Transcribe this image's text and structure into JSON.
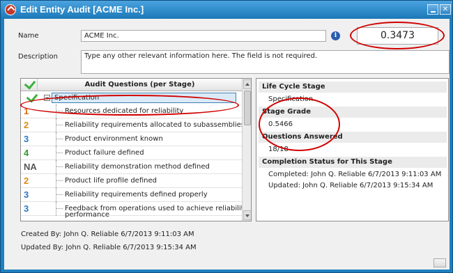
{
  "window": {
    "title": "Edit Entity Audit [ACME Inc.]",
    "close_glyph": "✕"
  },
  "form": {
    "name_label": "Name",
    "name_value": "ACME Inc.",
    "description_label": "Description",
    "description_value": "Type any other relevant information here. The field is not required.",
    "score": "0.3473",
    "info_glyph": "i"
  },
  "questions": {
    "header": "Audit Questions (per Stage)",
    "stage": "Specification",
    "rows": [
      {
        "grade": "1",
        "color": "#e06a10",
        "text": "Resources dedicated for reliability"
      },
      {
        "grade": "2",
        "color": "#e08a10",
        "text": "Reliability requirements allocated to subassemblies"
      },
      {
        "grade": "3",
        "color": "#2a78c8",
        "text": "Product environment known"
      },
      {
        "grade": "4",
        "color": "#2e9a2e",
        "text": "Product failure defined"
      },
      {
        "grade": "NA",
        "color": "#555555",
        "text": "Reliability demonstration method defined"
      },
      {
        "grade": "2",
        "color": "#e08a10",
        "text": "Product life profile defined"
      },
      {
        "grade": "3",
        "color": "#2a78c8",
        "text": "Reliability requirements defined properly"
      },
      {
        "grade": "3",
        "color": "#2a78c8",
        "text": "Feedback from operations used to achieve reliability"
      },
      {
        "grade": "",
        "color": "#222222",
        "text": "performance"
      }
    ]
  },
  "details": {
    "life_cycle_label": "Life Cycle Stage",
    "life_cycle_value": "Specification",
    "stage_grade_label": "Stage Grade",
    "stage_grade_value": "0.5466",
    "questions_answered_label": "Questions Answered",
    "questions_answered_value": "18/18",
    "completion_label": "Completion Status for This Stage",
    "completed_text": "Completed: John Q. Reliable 6/7/2013 9:11:03 AM",
    "updated_text": "Updated: John Q. Reliable 6/7/2013 9:15:34 AM"
  },
  "footer": {
    "created_by": "Created By: John Q. Reliable 6/7/2013 9:11:03 AM",
    "updated_by": "Updated By: John Q. Reliable 6/7/2013 9:15:34 AM"
  },
  "colors": {
    "title_bar": "#1b78b8",
    "highlight_oval": "#d00000",
    "check_green": "#3bb23b"
  }
}
